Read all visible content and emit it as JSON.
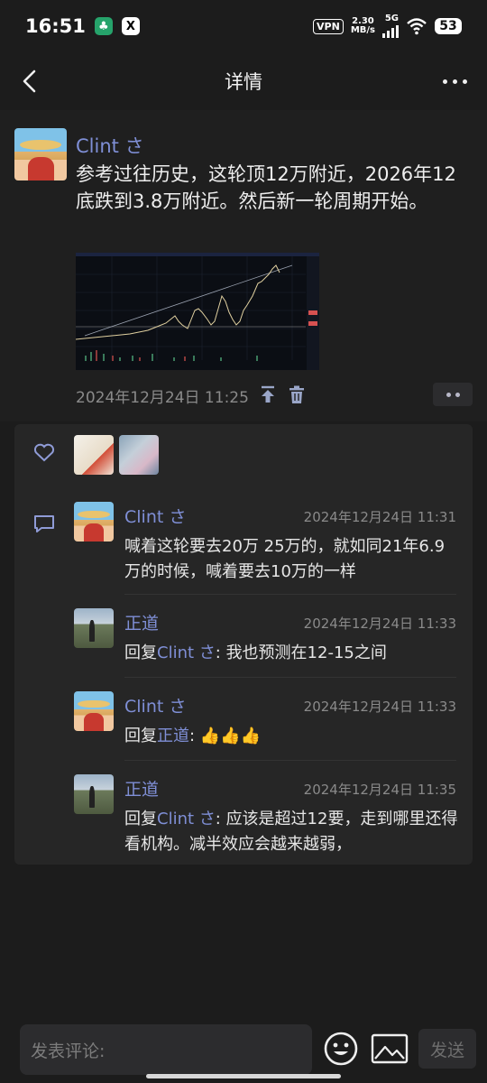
{
  "status_bar": {
    "time": "16:51",
    "vpn": "VPN",
    "speed_value": "2.30",
    "speed_unit": "MB/s",
    "network": "5G",
    "battery": "53"
  },
  "nav": {
    "title": "详情",
    "back_icon": "chevron-left-icon",
    "more_icon": "more-horizontal-icon"
  },
  "post": {
    "author": "Clint さ",
    "text": "参考过往历史，这轮顶12万附近，2026年12底跌到3.8万附近。然后新一轮周期开始。",
    "time": "2024年12月24日 11:25",
    "share_icon": "pin-top-icon",
    "delete_icon": "trash-icon"
  },
  "likes": {
    "icon": "heart-icon"
  },
  "comments": [
    {
      "author": "Clint さ",
      "time": "2024年12月24日 11:31",
      "text": "喊着这轮要去20万 25万的，就如同21年6.9万的时候，喊着要去10万的一样",
      "reply_prefix": "",
      "reply_to": "",
      "reply_sep": ""
    },
    {
      "author": "正道",
      "time": "2024年12月24日 11:33",
      "reply_prefix": "回复",
      "reply_to": "Clint さ",
      "reply_sep": ": ",
      "text": "我也预测在12-15之间"
    },
    {
      "author": "Clint さ",
      "time": "2024年12月24日 11:33",
      "reply_prefix": "回复",
      "reply_to": "正道",
      "reply_sep": ": ",
      "text": "👍👍👍"
    },
    {
      "author": "正道",
      "time": "2024年12月24日 11:35",
      "reply_prefix": "回复",
      "reply_to": "Clint さ",
      "reply_sep": ": ",
      "text": "应该是超过12要，走到哪里还得看机构。减半效应会越来越弱，"
    }
  ],
  "composer": {
    "placeholder": "发表评论:",
    "send_label": "发送",
    "emoji_icon": "smiley-icon",
    "image_icon": "image-icon"
  },
  "colors": {
    "background": "#1c1c1c",
    "card": "#262626",
    "accent_name": "#7f8fd6",
    "muted": "#8a8a8a"
  }
}
